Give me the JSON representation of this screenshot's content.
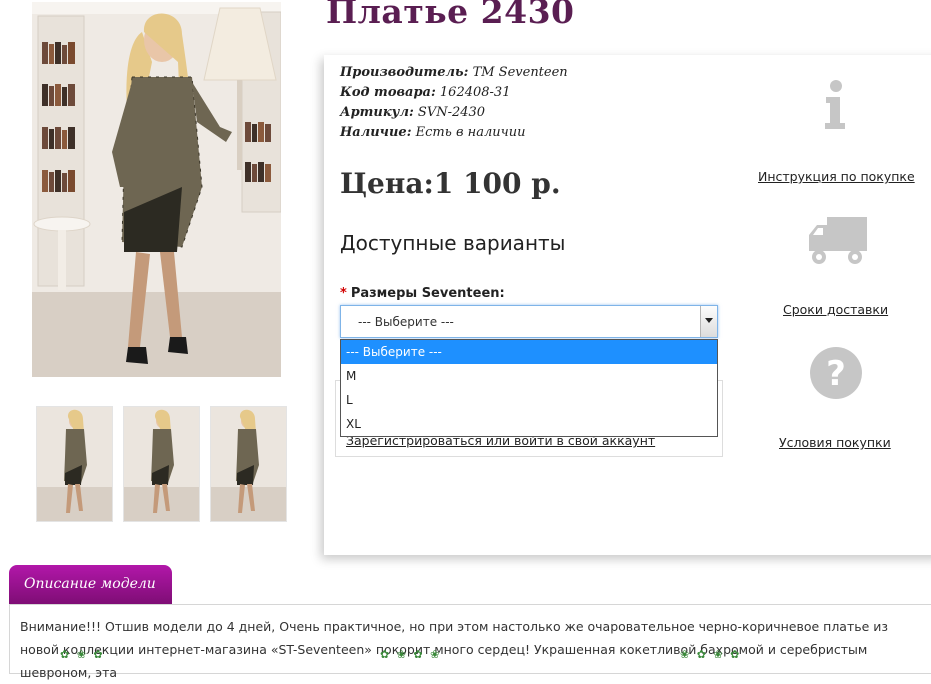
{
  "product": {
    "title": "Платье 2430",
    "info": [
      {
        "key": "Производитель:",
        "value": "ТМ Seventeen"
      },
      {
        "key": "Код товара:",
        "value": "162408-31"
      },
      {
        "key": "Артикул:",
        "value": "SVN-2430"
      },
      {
        "key": "Наличие:",
        "value": "Есть в наличии"
      }
    ],
    "price": "Цена:1 100 р."
  },
  "variants": {
    "heading": "Доступные варианты",
    "required_mark": "*",
    "size_label": "Размеры Seventeen:",
    "select_value": "--- Выберите ---",
    "options": [
      "--- Выберите ---",
      "M",
      "L",
      "XL"
    ],
    "selected_option": 0
  },
  "login": {
    "link": "Зарегистрироваться или войти в свой аккаунт"
  },
  "sidebar": {
    "instruction": "Инструкция по покупке",
    "delivery": "Сроки доставки",
    "conditions": "Условия покупки"
  },
  "description": {
    "tab": "Описание модели",
    "text": "Внимание!!! Отшив модели до 4 дней, Очень практичное, но при этом настолько же очаровательное черно-коричневое платье из новой коллекции интернет-магазина «ST-Seventeen» покорит много сердец! Украшенная кокетливой бахромой и серебристым шевроном, эта"
  },
  "colors": {
    "title": "#5a1e52",
    "tab_start": "#b217a9",
    "tab_end": "#7d0d74",
    "option_selected": "#1e90ff",
    "icon_gray": "#c6c6c6",
    "required": "#d20000"
  },
  "icons": [
    "info-icon",
    "truck-icon",
    "question-icon"
  ]
}
